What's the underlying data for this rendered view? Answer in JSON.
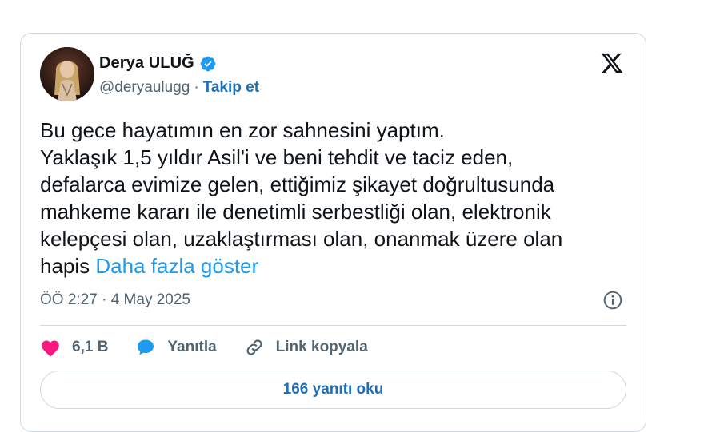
{
  "author": {
    "name": "Derya ULUĞ",
    "handle": "@deryaulugg",
    "separator": "·",
    "follow_label": "Takip et"
  },
  "tweet": {
    "lines": [
      "Bu gece hayatımın en zor sahnesini yaptım.",
      "Yaklaşık 1,5 yıldır Asil'i ve beni tehdit ve taciz eden,",
      "defalarca evimize gelen, ettiğimiz şikayet doğrultusunda",
      "mahkeme kararı ile denetimli serbestliği olan, elektronik",
      "kelepçesi olan, uzaklaştırması olan, onanmak üzere olan"
    ],
    "last_line_start": "hapis ",
    "show_more": "Daha fazla göster"
  },
  "meta": {
    "timestamp": "ÖÖ 2:27 · 4 May 2025"
  },
  "actions": {
    "like_count": "6,1 B",
    "reply_label": "Yanıtla",
    "copy_link_label": "Link kopyala"
  },
  "replies_button": {
    "label": "166 yanıtı oku"
  },
  "colors": {
    "link": "#1d9bf0",
    "follow": "#1d6fb8",
    "like": "#f91880",
    "reply": "#1d9bf0",
    "verified": "#1d9bf0"
  },
  "icons": {
    "verified": "verified-badge-icon",
    "logo": "x-logo-icon",
    "info": "info-icon",
    "like": "heart-icon",
    "reply": "speech-bubble-icon",
    "link": "link-icon"
  }
}
